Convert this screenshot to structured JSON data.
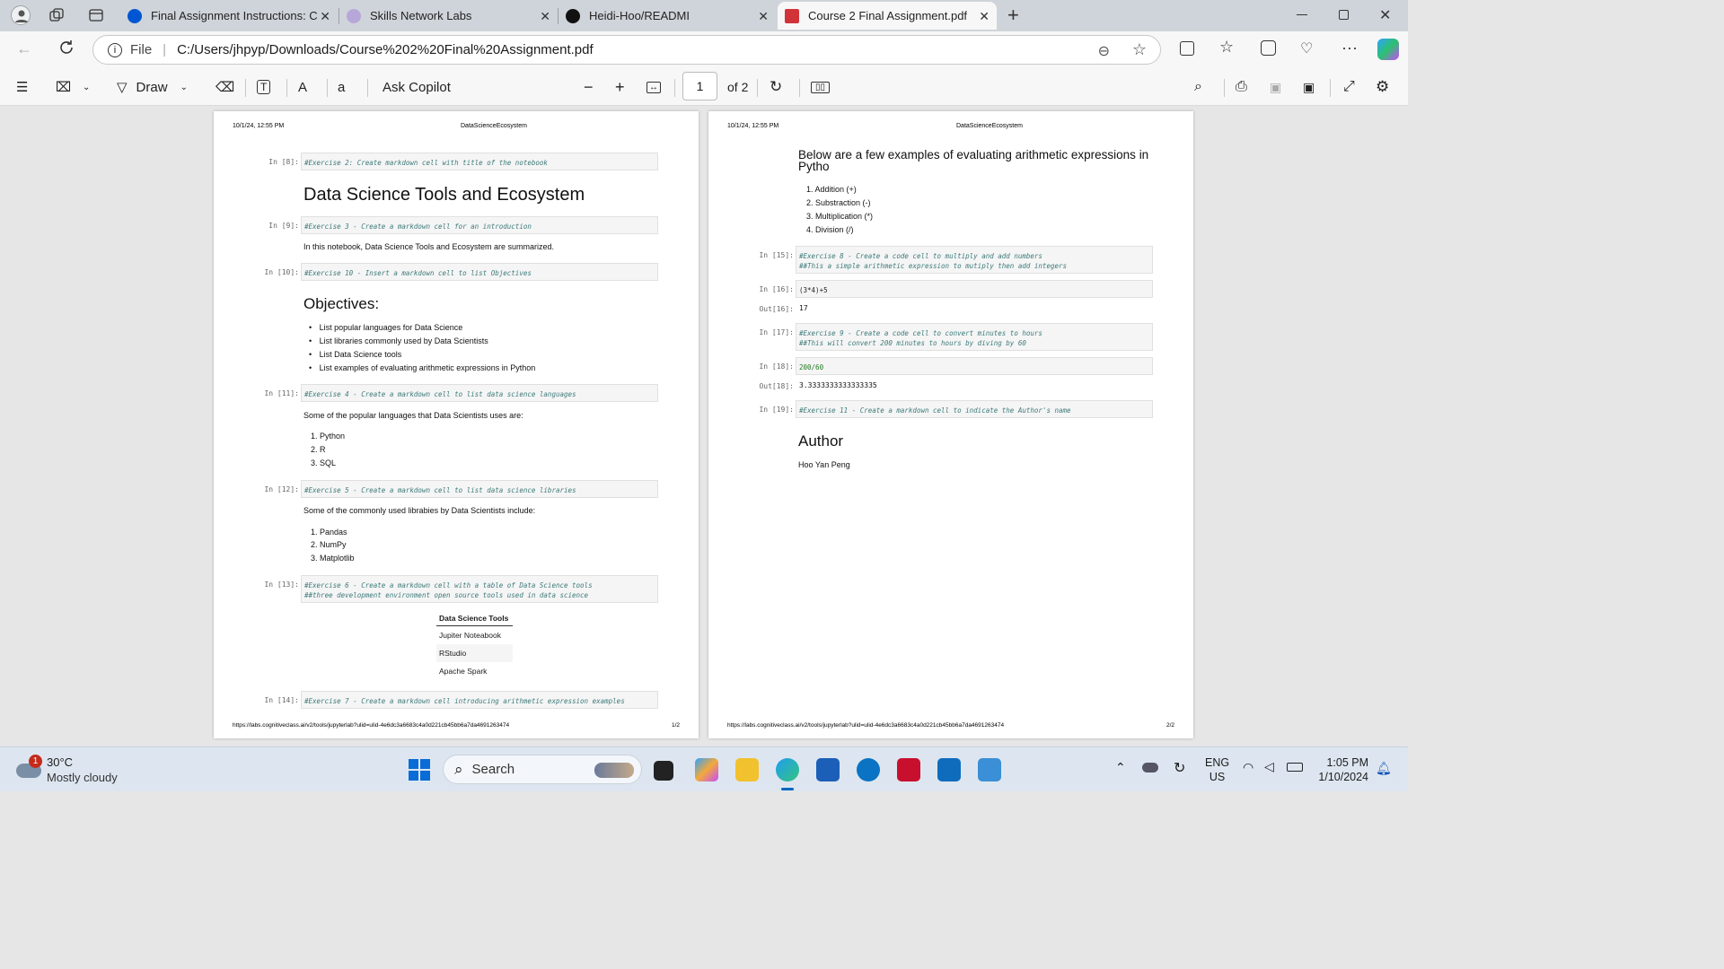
{
  "tabs": [
    {
      "title": "Final Assignment Instructions: Cre",
      "active": false
    },
    {
      "title": "Skills Network Labs",
      "active": false
    },
    {
      "title": "Heidi-Hoo/READMI",
      "active": false
    },
    {
      "title": "Course 2 Final Assignment.pdf",
      "active": true
    }
  ],
  "address": {
    "scheme_label": "File",
    "url": "C:/Users/jhpyp/Downloads/Course%202%20Final%20Assignment.pdf"
  },
  "pdf_toolbar": {
    "draw_label": "Draw",
    "ask_copilot_label": "Ask Copilot",
    "page_number": "1",
    "page_total": "of 2"
  },
  "page1": {
    "header_date": "10/1/24, 12:55 PM",
    "header_title": "DataScienceEcosystem",
    "cells": [
      {
        "prompt": "In [8]:",
        "code": "#Exercise 2: Create markdown cell with title of the notebook"
      },
      {
        "prompt": "In [9]:",
        "code": "#Exercise 3 - Create a markdown cell for an introduction"
      },
      {
        "prompt": "In [10]:",
        "code": "#Exercise 10 - Insert a markdown cell to list Objectives"
      },
      {
        "prompt": "In [11]:",
        "code": "#Exercise 4 - Create a markdown cell to list data science languages"
      },
      {
        "prompt": "In [12]:",
        "code": "#Exercise 5 - Create a markdown cell to list data science libraries"
      },
      {
        "prompt": "In [13]:",
        "code": "#Exercise 6 - Create a markdown cell with a table of Data Science tools",
        "code2": "##three development environment open source tools used in data science"
      },
      {
        "prompt": "In [14]:",
        "code": "#Exercise 7 - Create a markdown cell introducing arithmetic expression examples"
      }
    ],
    "title": "Data Science Tools and Ecosystem",
    "intro": "In this notebook, Data Science Tools and Ecosystem are summarized.",
    "objectives_heading": "Objectives:",
    "objectives": [
      "List popular languages for Data Science",
      "List libraries commonly used by Data Scientists",
      "List Data Science tools",
      "List examples of evaluating arithmetic expressions in Python"
    ],
    "languages_intro": "Some of the popular languages that Data Scientists uses are:",
    "languages": [
      "1. Python",
      "2. R",
      "3. SQL"
    ],
    "libraries_intro": "Some of the commonly used librabies by Data Scientists include:",
    "libraries": [
      "1. Pandas",
      "2. NumPy",
      "3. Matplotlib"
    ],
    "tools_header": "Data Science Tools",
    "tools": [
      "Jupiter Noteabook",
      "RStudio",
      "Apache Spark"
    ],
    "footer_url": "https://labs.cognitiveclass.ai/v2/tools/jupyterlab?ulid=ulid-4e6dc3a6683c4a0d221cb45bb6a7da4691263474",
    "footer_page": "1/2"
  },
  "page2": {
    "header_date": "10/1/24, 12:55 PM",
    "header_title": "DataScienceEcosystem",
    "heading": "Below are a few examples of evaluating arithmetic expressions in Pytho",
    "ops": [
      "1. Addition (+)",
      "2. Substraction (-)",
      "3. Multiplication (*)",
      "4. Division (/)"
    ],
    "cells": [
      {
        "prompt": "In [15]:",
        "code": "#Exercise 8 - Create a code cell to multiply and add numbers",
        "code2": "##This a simple arithmetic expression to mutiply then add integers"
      },
      {
        "prompt": "In [16]:",
        "code": "(3*4)+5"
      },
      {
        "prompt": "In [17]:",
        "code": "#Exercise 9 - Create a code cell to convert minutes to hours",
        "code2": "##This will convert 200 minutes to hours by diving by 60"
      },
      {
        "prompt": "In [18]:",
        "code": "200/60"
      },
      {
        "prompt": "In [19]:",
        "code": "#Exercise 11 - Create a markdown cell to indicate the Author's name"
      }
    ],
    "outputs": [
      {
        "prompt": "Out[16]:",
        "value": "17"
      },
      {
        "prompt": "Out[18]:",
        "value": "3.3333333333333335"
      }
    ],
    "author_heading": "Author",
    "author_name": "Hoo Yan Peng",
    "footer_url": "https://labs.cognitiveclass.ai/v2/tools/jupyterlab?ulid=ulid-4e6dc3a6683c4a0d221cb45bb6a7da4691263474",
    "footer_page": "2/2"
  },
  "taskbar": {
    "weather_temp": "30°C",
    "weather_desc": "Mostly cloudy",
    "weather_badge": "1",
    "search_label": "Search",
    "lang": "ENG",
    "region": "US",
    "time": "1:05 PM",
    "date": "1/10/2024"
  },
  "colors": {
    "accent": "#0067c0",
    "code_text": "#3d7a7a",
    "pdf_red": "#d13438"
  }
}
